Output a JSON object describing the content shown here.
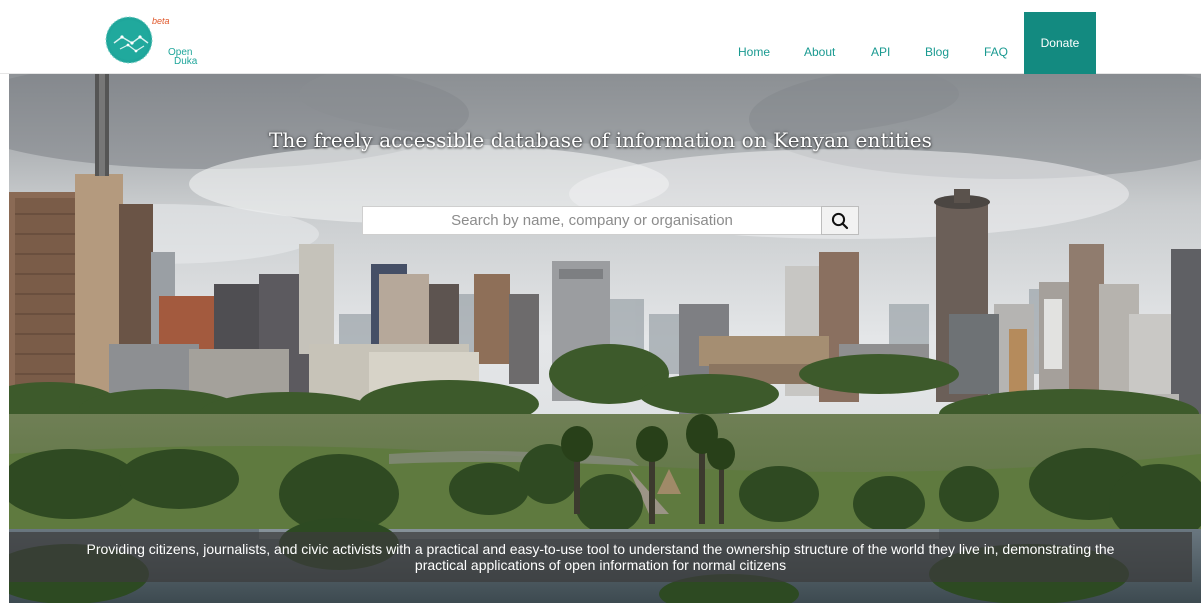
{
  "brand": {
    "badge": "beta",
    "name_line1": "Open",
    "name_line2": "Duka",
    "color": "#1fa69b"
  },
  "nav": {
    "items": [
      {
        "label": "Home"
      },
      {
        "label": "About"
      },
      {
        "label": "API"
      },
      {
        "label": "Blog"
      },
      {
        "label": "FAQ"
      }
    ],
    "donate_label": "Donate",
    "link_color": "#1a9a91",
    "donate_color": "#138a80"
  },
  "hero": {
    "tagline": "The freely accessible database of information on Kenyan entities",
    "search": {
      "placeholder": "Search by name, company or organisation",
      "value": "",
      "button_icon": "search-icon"
    },
    "caption": "Providing citizens, journalists, and civic activists with a practical and easy-to-use tool to understand the ownership structure of the world they live in, demonstrating the practical applications of open information for normal citizens"
  }
}
